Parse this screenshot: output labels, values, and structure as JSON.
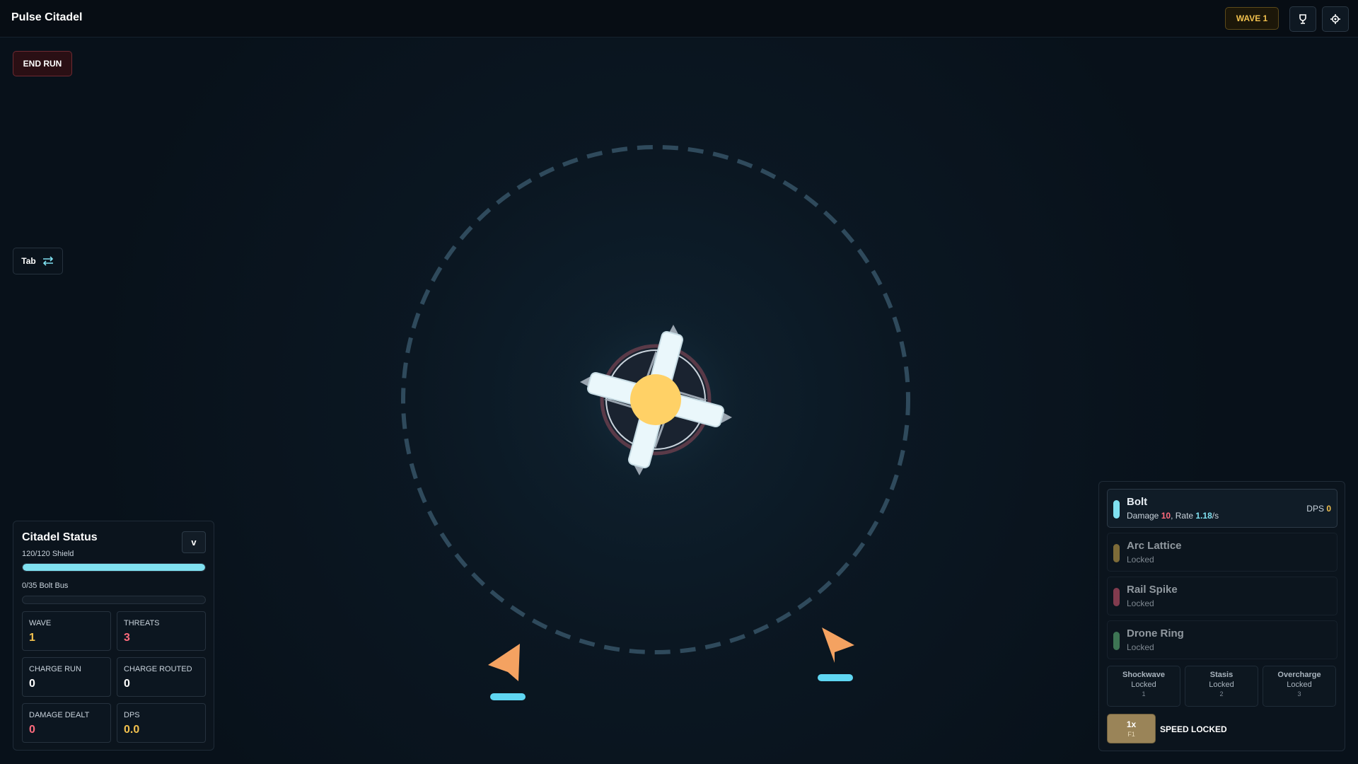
{
  "app": {
    "title": "Pulse Citadel"
  },
  "header": {
    "wave_badge": "WAVE 1",
    "trophy_icon": "trophy-icon",
    "settings_icon": "gear-icon"
  },
  "controls": {
    "end_run": "END RUN",
    "tab_label": "Tab",
    "tab_icon": "swap-icon"
  },
  "status": {
    "title": "Citadel Status",
    "collapse_label": "v",
    "shield_text": "120/120 Shield",
    "shield_fraction": 1.0,
    "bus_text": "0/35 Bolt Bus",
    "bus_fraction": 0.0,
    "stats": [
      {
        "label": "WAVE",
        "value": "1",
        "color": "#f2c14e"
      },
      {
        "label": "THREATS",
        "value": "3",
        "color": "#ff6b7d"
      },
      {
        "label": "CHARGE RUN",
        "value": "0",
        "color": "#ffffff"
      },
      {
        "label": "CHARGE ROUTED",
        "value": "0",
        "color": "#ffffff"
      },
      {
        "label": "DAMAGE DEALT",
        "value": "0",
        "color": "#ff6b7d"
      },
      {
        "label": "DPS",
        "value": "0.0",
        "color": "#f2c14e"
      }
    ]
  },
  "weapons": {
    "active": {
      "name": "Bolt",
      "damage_label": "Damage",
      "damage": "10",
      "rate_label": ", Rate",
      "rate": "1.18",
      "rate_unit": "/s",
      "dps_label": "DPS",
      "dps": "0",
      "color": "#7fe0f0"
    },
    "locked": [
      {
        "name": "Arc Lattice",
        "status": "Locked",
        "color": "#c9a64a"
      },
      {
        "name": "Rail Spike",
        "status": "Locked",
        "color": "#d0566f"
      },
      {
        "name": "Drone Ring",
        "status": "Locked",
        "color": "#5fb67a"
      }
    ],
    "abilities": [
      {
        "name": "Shockwave",
        "status": "Locked",
        "key": "1"
      },
      {
        "name": "Stasis",
        "status": "Locked",
        "key": "2"
      },
      {
        "name": "Overcharge",
        "status": "Locked",
        "key": "3"
      }
    ],
    "speed": {
      "value": "1x",
      "key": "F1",
      "status": "SPEED LOCKED"
    }
  },
  "palette": {
    "accent": "#7fe0f0",
    "gold": "#f2c14e",
    "danger": "#ff6b7d",
    "enemy": "#f4a261",
    "core": "#ffd166"
  }
}
